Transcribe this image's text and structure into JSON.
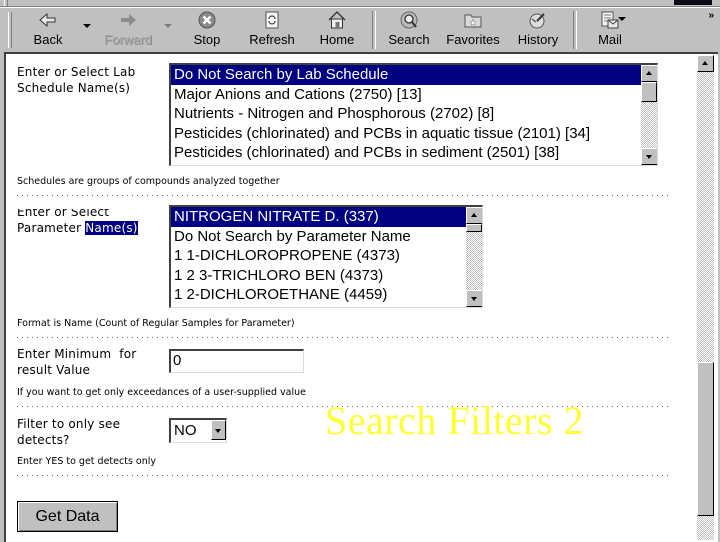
{
  "toolbar": {
    "buttons": [
      {
        "label": "Back",
        "icon": "back-arrow-icon",
        "enabled": true
      },
      {
        "label": "Forward",
        "icon": "forward-arrow-icon",
        "enabled": false
      },
      {
        "label": "Stop",
        "icon": "stop-icon",
        "enabled": true
      },
      {
        "label": "Refresh",
        "icon": "refresh-icon",
        "enabled": true
      },
      {
        "label": "Home",
        "icon": "home-icon",
        "enabled": true
      },
      {
        "label": "Search",
        "icon": "search-icon",
        "enabled": true
      },
      {
        "label": "Favorites",
        "icon": "favorites-folder-icon",
        "enabled": true
      },
      {
        "label": "History",
        "icon": "history-icon",
        "enabled": true
      },
      {
        "label": "Mail",
        "icon": "mail-icon",
        "enabled": true
      }
    ],
    "overflow": "»"
  },
  "form": {
    "lab_schedule": {
      "label_line1": "Enter or Select Lab",
      "label_line2": "Schedule Name(s)",
      "options": [
        "Do Not Search by Lab Schedule",
        "Major Anions and Cations (2750) [13]",
        "Nutrients - Nitrogen and Phosphorous (2702) [8]",
        "Pesticides (chlorinated) and PCBs in aquatic tissue (2101) [34]",
        "Pesticides (chlorinated) and PCBs in sediment (2501) [38]"
      ],
      "selected_index": 0,
      "hint": "Schedules are groups of compounds analyzed together"
    },
    "parameter": {
      "label_line1": "Enter or Select",
      "label_line2_prefix": "Parameter ",
      "label_line2_highlight": "Name(s)",
      "options": [
        "NITROGEN NITRATE D. (337)",
        "Do Not Search by Parameter Name",
        "1 1-DICHLOROPROPENE (4373)",
        "1 2 3-TRICHLORO BEN (4373)",
        "1 2-DICHLOROETHANE (4459)"
      ],
      "selected_index": 0,
      "hint": "Format is Name (Count of Regular Samples for Parameter)"
    },
    "minimum": {
      "label_line1": "Enter Minimum  for",
      "label_line2": "result Value",
      "value": "0",
      "hint": "If you want to get only exceedances of a user-supplied value"
    },
    "detects": {
      "label_line1": "Filter to only see",
      "label_line2": "detects?",
      "value": "NO",
      "hint": "Enter YES to get detects only"
    },
    "submit_label": "Get Data"
  },
  "overlay": {
    "title": "Search Filters 2",
    "color": "#ffff33"
  },
  "colors": {
    "selection": "#000080",
    "chrome": "#c0c0c0"
  }
}
